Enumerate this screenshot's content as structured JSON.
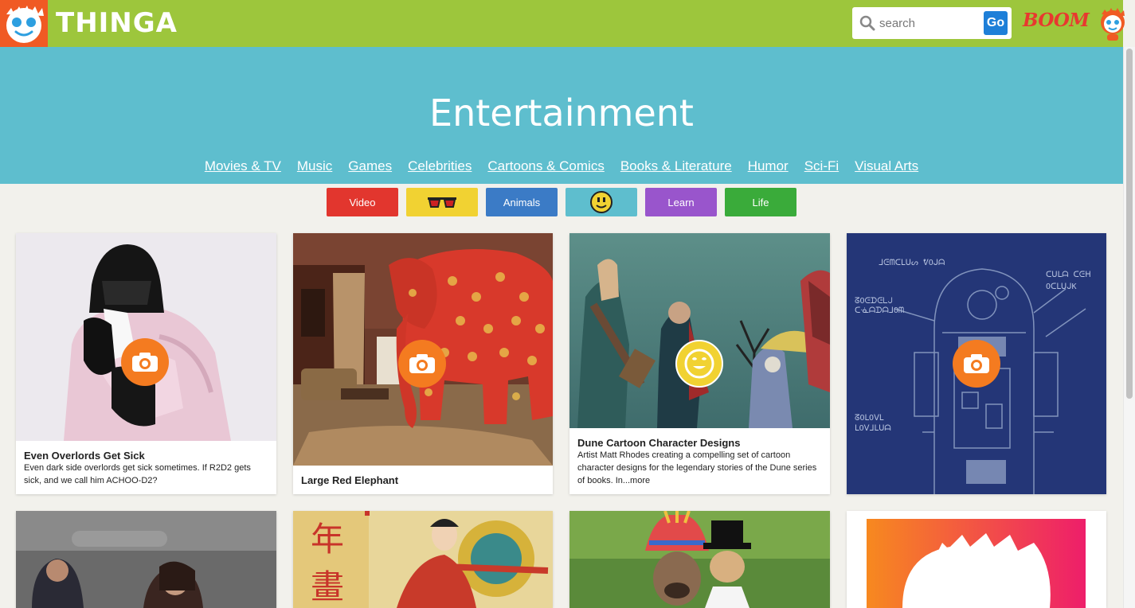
{
  "header": {
    "logo_text": "THINGA",
    "search_placeholder": "search",
    "go_label": "Go",
    "boom_label": "BOOM"
  },
  "hero": {
    "title": "Entertainment",
    "categories": [
      "Movies & TV",
      "Music",
      "Games",
      "Celebrities",
      "Cartoons & Comics",
      "Books & Literature",
      "Humor",
      "Sci-Fi",
      "Visual Arts"
    ]
  },
  "pills": [
    {
      "label": "Video",
      "color": "#e2362e"
    },
    {
      "label": "",
      "color": "#f1d232",
      "icon": "sunglasses-icon"
    },
    {
      "label": "Animals",
      "color": "#3b7bc6"
    },
    {
      "label": "",
      "color": "#5ebece",
      "icon": "smiley-icon"
    },
    {
      "label": "Learn",
      "color": "#9955cc"
    },
    {
      "label": "Life",
      "color": "#3aab3a"
    }
  ],
  "cards": [
    {
      "title": "Even Overlords Get Sick",
      "description": "Even dark side overlords get sick sometimes. If R2D2 gets sick, and we call him ACHOO-D2?",
      "badge": "camera-icon"
    },
    {
      "title": "Large Red Elephant",
      "description": "",
      "badge": "camera-icon"
    },
    {
      "title": "Dune Cartoon Character Designs",
      "description": "Artist Matt Rhodes creating a compelling set of cartoon character designs for the legendary stories of the Dune series of books.  In...more",
      "badge": "smiley-icon"
    },
    {
      "title": "",
      "description": "",
      "badge": "camera-icon"
    }
  ],
  "blueprint_text": {
    "top": "ᒧᕮᗰᑕᒪᑌᔕ ᕓOᒍᗩ",
    "right1": "ᑕᑌᒪᗩ ᑕᕮᕼ",
    "right2": "OᑕᒪᑌᒍK",
    "left1": "ᘔOᕮᗪᕮᒪᒍ",
    "left2": "ᑕᓍᗩᗪᗩᒧOᗰ",
    "bottom1": "ᘔOᒪOᐯᒪ",
    "bottom2": "ᒪOᐯᒧᒪᑌᗩ"
  },
  "colors": {
    "topbar": "#9dc63c",
    "hero": "#5ebece",
    "badge_orange": "#f47b20",
    "badge_yellow": "#f1d232"
  }
}
